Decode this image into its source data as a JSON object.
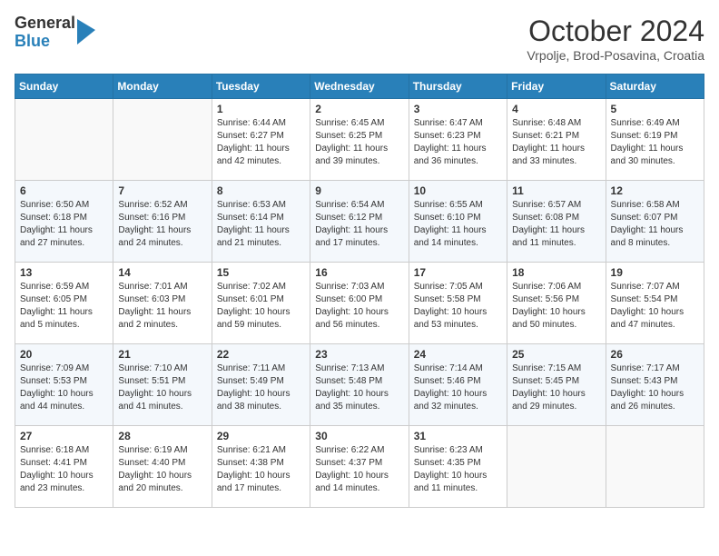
{
  "header": {
    "logo_line1": "General",
    "logo_line2": "Blue",
    "month": "October 2024",
    "location": "Vrpolje, Brod-Posavina, Croatia"
  },
  "weekdays": [
    "Sunday",
    "Monday",
    "Tuesday",
    "Wednesday",
    "Thursday",
    "Friday",
    "Saturday"
  ],
  "weeks": [
    [
      {
        "day": "",
        "info": ""
      },
      {
        "day": "",
        "info": ""
      },
      {
        "day": "1",
        "info": "Sunrise: 6:44 AM\nSunset: 6:27 PM\nDaylight: 11 hours and 42 minutes."
      },
      {
        "day": "2",
        "info": "Sunrise: 6:45 AM\nSunset: 6:25 PM\nDaylight: 11 hours and 39 minutes."
      },
      {
        "day": "3",
        "info": "Sunrise: 6:47 AM\nSunset: 6:23 PM\nDaylight: 11 hours and 36 minutes."
      },
      {
        "day": "4",
        "info": "Sunrise: 6:48 AM\nSunset: 6:21 PM\nDaylight: 11 hours and 33 minutes."
      },
      {
        "day": "5",
        "info": "Sunrise: 6:49 AM\nSunset: 6:19 PM\nDaylight: 11 hours and 30 minutes."
      }
    ],
    [
      {
        "day": "6",
        "info": "Sunrise: 6:50 AM\nSunset: 6:18 PM\nDaylight: 11 hours and 27 minutes."
      },
      {
        "day": "7",
        "info": "Sunrise: 6:52 AM\nSunset: 6:16 PM\nDaylight: 11 hours and 24 minutes."
      },
      {
        "day": "8",
        "info": "Sunrise: 6:53 AM\nSunset: 6:14 PM\nDaylight: 11 hours and 21 minutes."
      },
      {
        "day": "9",
        "info": "Sunrise: 6:54 AM\nSunset: 6:12 PM\nDaylight: 11 hours and 17 minutes."
      },
      {
        "day": "10",
        "info": "Sunrise: 6:55 AM\nSunset: 6:10 PM\nDaylight: 11 hours and 14 minutes."
      },
      {
        "day": "11",
        "info": "Sunrise: 6:57 AM\nSunset: 6:08 PM\nDaylight: 11 hours and 11 minutes."
      },
      {
        "day": "12",
        "info": "Sunrise: 6:58 AM\nSunset: 6:07 PM\nDaylight: 11 hours and 8 minutes."
      }
    ],
    [
      {
        "day": "13",
        "info": "Sunrise: 6:59 AM\nSunset: 6:05 PM\nDaylight: 11 hours and 5 minutes."
      },
      {
        "day": "14",
        "info": "Sunrise: 7:01 AM\nSunset: 6:03 PM\nDaylight: 11 hours and 2 minutes."
      },
      {
        "day": "15",
        "info": "Sunrise: 7:02 AM\nSunset: 6:01 PM\nDaylight: 10 hours and 59 minutes."
      },
      {
        "day": "16",
        "info": "Sunrise: 7:03 AM\nSunset: 6:00 PM\nDaylight: 10 hours and 56 minutes."
      },
      {
        "day": "17",
        "info": "Sunrise: 7:05 AM\nSunset: 5:58 PM\nDaylight: 10 hours and 53 minutes."
      },
      {
        "day": "18",
        "info": "Sunrise: 7:06 AM\nSunset: 5:56 PM\nDaylight: 10 hours and 50 minutes."
      },
      {
        "day": "19",
        "info": "Sunrise: 7:07 AM\nSunset: 5:54 PM\nDaylight: 10 hours and 47 minutes."
      }
    ],
    [
      {
        "day": "20",
        "info": "Sunrise: 7:09 AM\nSunset: 5:53 PM\nDaylight: 10 hours and 44 minutes."
      },
      {
        "day": "21",
        "info": "Sunrise: 7:10 AM\nSunset: 5:51 PM\nDaylight: 10 hours and 41 minutes."
      },
      {
        "day": "22",
        "info": "Sunrise: 7:11 AM\nSunset: 5:49 PM\nDaylight: 10 hours and 38 minutes."
      },
      {
        "day": "23",
        "info": "Sunrise: 7:13 AM\nSunset: 5:48 PM\nDaylight: 10 hours and 35 minutes."
      },
      {
        "day": "24",
        "info": "Sunrise: 7:14 AM\nSunset: 5:46 PM\nDaylight: 10 hours and 32 minutes."
      },
      {
        "day": "25",
        "info": "Sunrise: 7:15 AM\nSunset: 5:45 PM\nDaylight: 10 hours and 29 minutes."
      },
      {
        "day": "26",
        "info": "Sunrise: 7:17 AM\nSunset: 5:43 PM\nDaylight: 10 hours and 26 minutes."
      }
    ],
    [
      {
        "day": "27",
        "info": "Sunrise: 6:18 AM\nSunset: 4:41 PM\nDaylight: 10 hours and 23 minutes."
      },
      {
        "day": "28",
        "info": "Sunrise: 6:19 AM\nSunset: 4:40 PM\nDaylight: 10 hours and 20 minutes."
      },
      {
        "day": "29",
        "info": "Sunrise: 6:21 AM\nSunset: 4:38 PM\nDaylight: 10 hours and 17 minutes."
      },
      {
        "day": "30",
        "info": "Sunrise: 6:22 AM\nSunset: 4:37 PM\nDaylight: 10 hours and 14 minutes."
      },
      {
        "day": "31",
        "info": "Sunrise: 6:23 AM\nSunset: 4:35 PM\nDaylight: 10 hours and 11 minutes."
      },
      {
        "day": "",
        "info": ""
      },
      {
        "day": "",
        "info": ""
      }
    ]
  ]
}
